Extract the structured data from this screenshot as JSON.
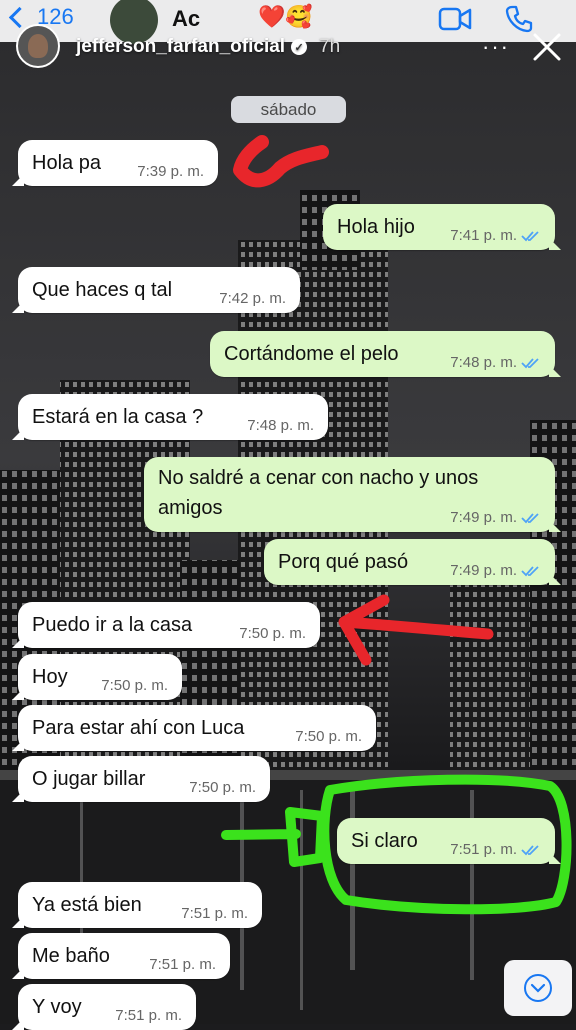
{
  "chat_header": {
    "back_count": "126",
    "contact_name": "Ac",
    "emoji": "❤️🥰"
  },
  "story": {
    "username": "jefferson_farfan_oficial",
    "time": "7h",
    "more": "···"
  },
  "date_label": "sábado",
  "messages": [
    {
      "text": "Hola pa",
      "time": "7:39 p. m."
    },
    {
      "text": "Hola hijo",
      "time": "7:41 p. m."
    },
    {
      "text": "Que haces q tal",
      "time": "7:42 p. m."
    },
    {
      "text": "Cortándome el pelo",
      "time": "7:48 p. m."
    },
    {
      "text": "Estará en la casa ?",
      "time": "7:48 p. m."
    },
    {
      "text": "No saldré a cenar con nacho y unos",
      "text2": "amigos",
      "time": "7:49 p. m."
    },
    {
      "text": "Porq qué pasó",
      "time": "7:49 p. m."
    },
    {
      "text": "Puedo ir a la casa",
      "time": "7:50 p. m."
    },
    {
      "text": "Hoy",
      "time": "7:50 p. m."
    },
    {
      "text": "Para estar ahí con Luca",
      "time": "7:50 p. m."
    },
    {
      "text": "O jugar billar",
      "time": "7:50 p. m."
    },
    {
      "text": "Si claro",
      "time": "7:51 p. m."
    },
    {
      "text": "Ya está bien",
      "time": "7:51 p. m."
    },
    {
      "text": "Me baño",
      "time": "7:51 p. m."
    },
    {
      "text": "Y voy",
      "time": "7:51 p. m."
    }
  ],
  "colors": {
    "incoming_bubble": "#ffffff",
    "outgoing_bubble": "#dcf8c6",
    "read_ticks": "#4fa3f7",
    "red_annotation": "#e8262b",
    "green_annotation": "#3be21c"
  },
  "icons": [
    "back-chevron-icon",
    "video-call-icon",
    "phone-icon",
    "verified-icon",
    "close-icon",
    "double-check-icon",
    "chevron-down-icon"
  ]
}
